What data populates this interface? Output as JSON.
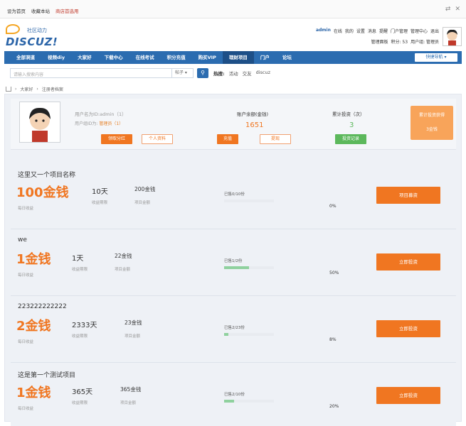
{
  "topbar": {
    "links": [
      "设为首页",
      "收藏本站",
      "商店首选用"
    ],
    "icons": [
      "swap-icon",
      "close-icon"
    ]
  },
  "header": {
    "logo_slogan": "社区动力",
    "logo_name": "DISCUZ!",
    "user_row1": [
      "admin",
      "在线",
      "我的",
      "设置",
      "消息",
      "提醒",
      "门户管理",
      "管理中心",
      "退出"
    ],
    "user_row2": [
      "管理面板",
      "积分: 53",
      "用户组: 管理员"
    ]
  },
  "nav": {
    "items": [
      "全部洞道",
      "视频diy",
      "大家好",
      "下载中心",
      "在线考试",
      "积分充值",
      "购买VIP",
      "理财项目",
      "门户",
      "论坛"
    ],
    "active_index": 7,
    "quick_label": "快捷导航 ▾"
  },
  "search": {
    "placeholder": "请输入搜索内容",
    "scope": "帖子 ▾",
    "hot_label": "热搜:",
    "hot_keywords": [
      "活动",
      "交友",
      "discuz"
    ]
  },
  "breadcrumb": [
    "大家好",
    "注册者档案"
  ],
  "user_card": {
    "name_line": "用户名为ID:admin（1）",
    "level_prefix": "用户组ID为:",
    "level_value": "管理员（1）",
    "btn_receive": "领取分红",
    "btn_profile": "个人资料",
    "balance_label": "账户余额(金钱)",
    "balance_value": "1651",
    "btn_recharge": "充值",
    "btn_withdraw": "提现",
    "invest_label": "累计投资（次）",
    "invest_value": "3",
    "btn_records": "投资记录",
    "total_title": "累计投资获得",
    "total_value": "3金钱",
    "colors": {
      "orange": "#f07621",
      "green": "#5cb85c"
    }
  },
  "projects": [
    {
      "title": "这里又一个项目名称",
      "rate": "100金钱",
      "rate_label": "每日收益",
      "days": "10天",
      "days_label": "收益期限",
      "amount": "200金钱",
      "amount_label": "项目金额",
      "sold": "已售0/10份",
      "progress": 0,
      "pct": "0%",
      "button": "项目募资"
    },
    {
      "title": "we",
      "rate": "1金钱",
      "rate_label": "每日收益",
      "days": "1天",
      "days_label": "收益期限",
      "amount": "22金钱",
      "amount_label": "项目金额",
      "sold": "已售1/2份",
      "progress": 0.5,
      "pct": "50%",
      "button": "立即投资"
    },
    {
      "title": "223222222222",
      "rate": "2金钱",
      "rate_label": "每日收益",
      "days": "2333天",
      "days_label": "收益期限",
      "amount": "23金钱",
      "amount_label": "项目金额",
      "sold": "已售2/23份",
      "progress": 0.08,
      "pct": "8%",
      "button": "立即投资"
    },
    {
      "title": "这是第一个测试项目",
      "rate": "1金钱",
      "rate_label": "每日收益",
      "days": "365天",
      "days_label": "收益期限",
      "amount": "365金钱",
      "amount_label": "项目金额",
      "sold": "已售2/10份",
      "progress": 0.2,
      "pct": "20%",
      "button": "立即投资"
    }
  ]
}
